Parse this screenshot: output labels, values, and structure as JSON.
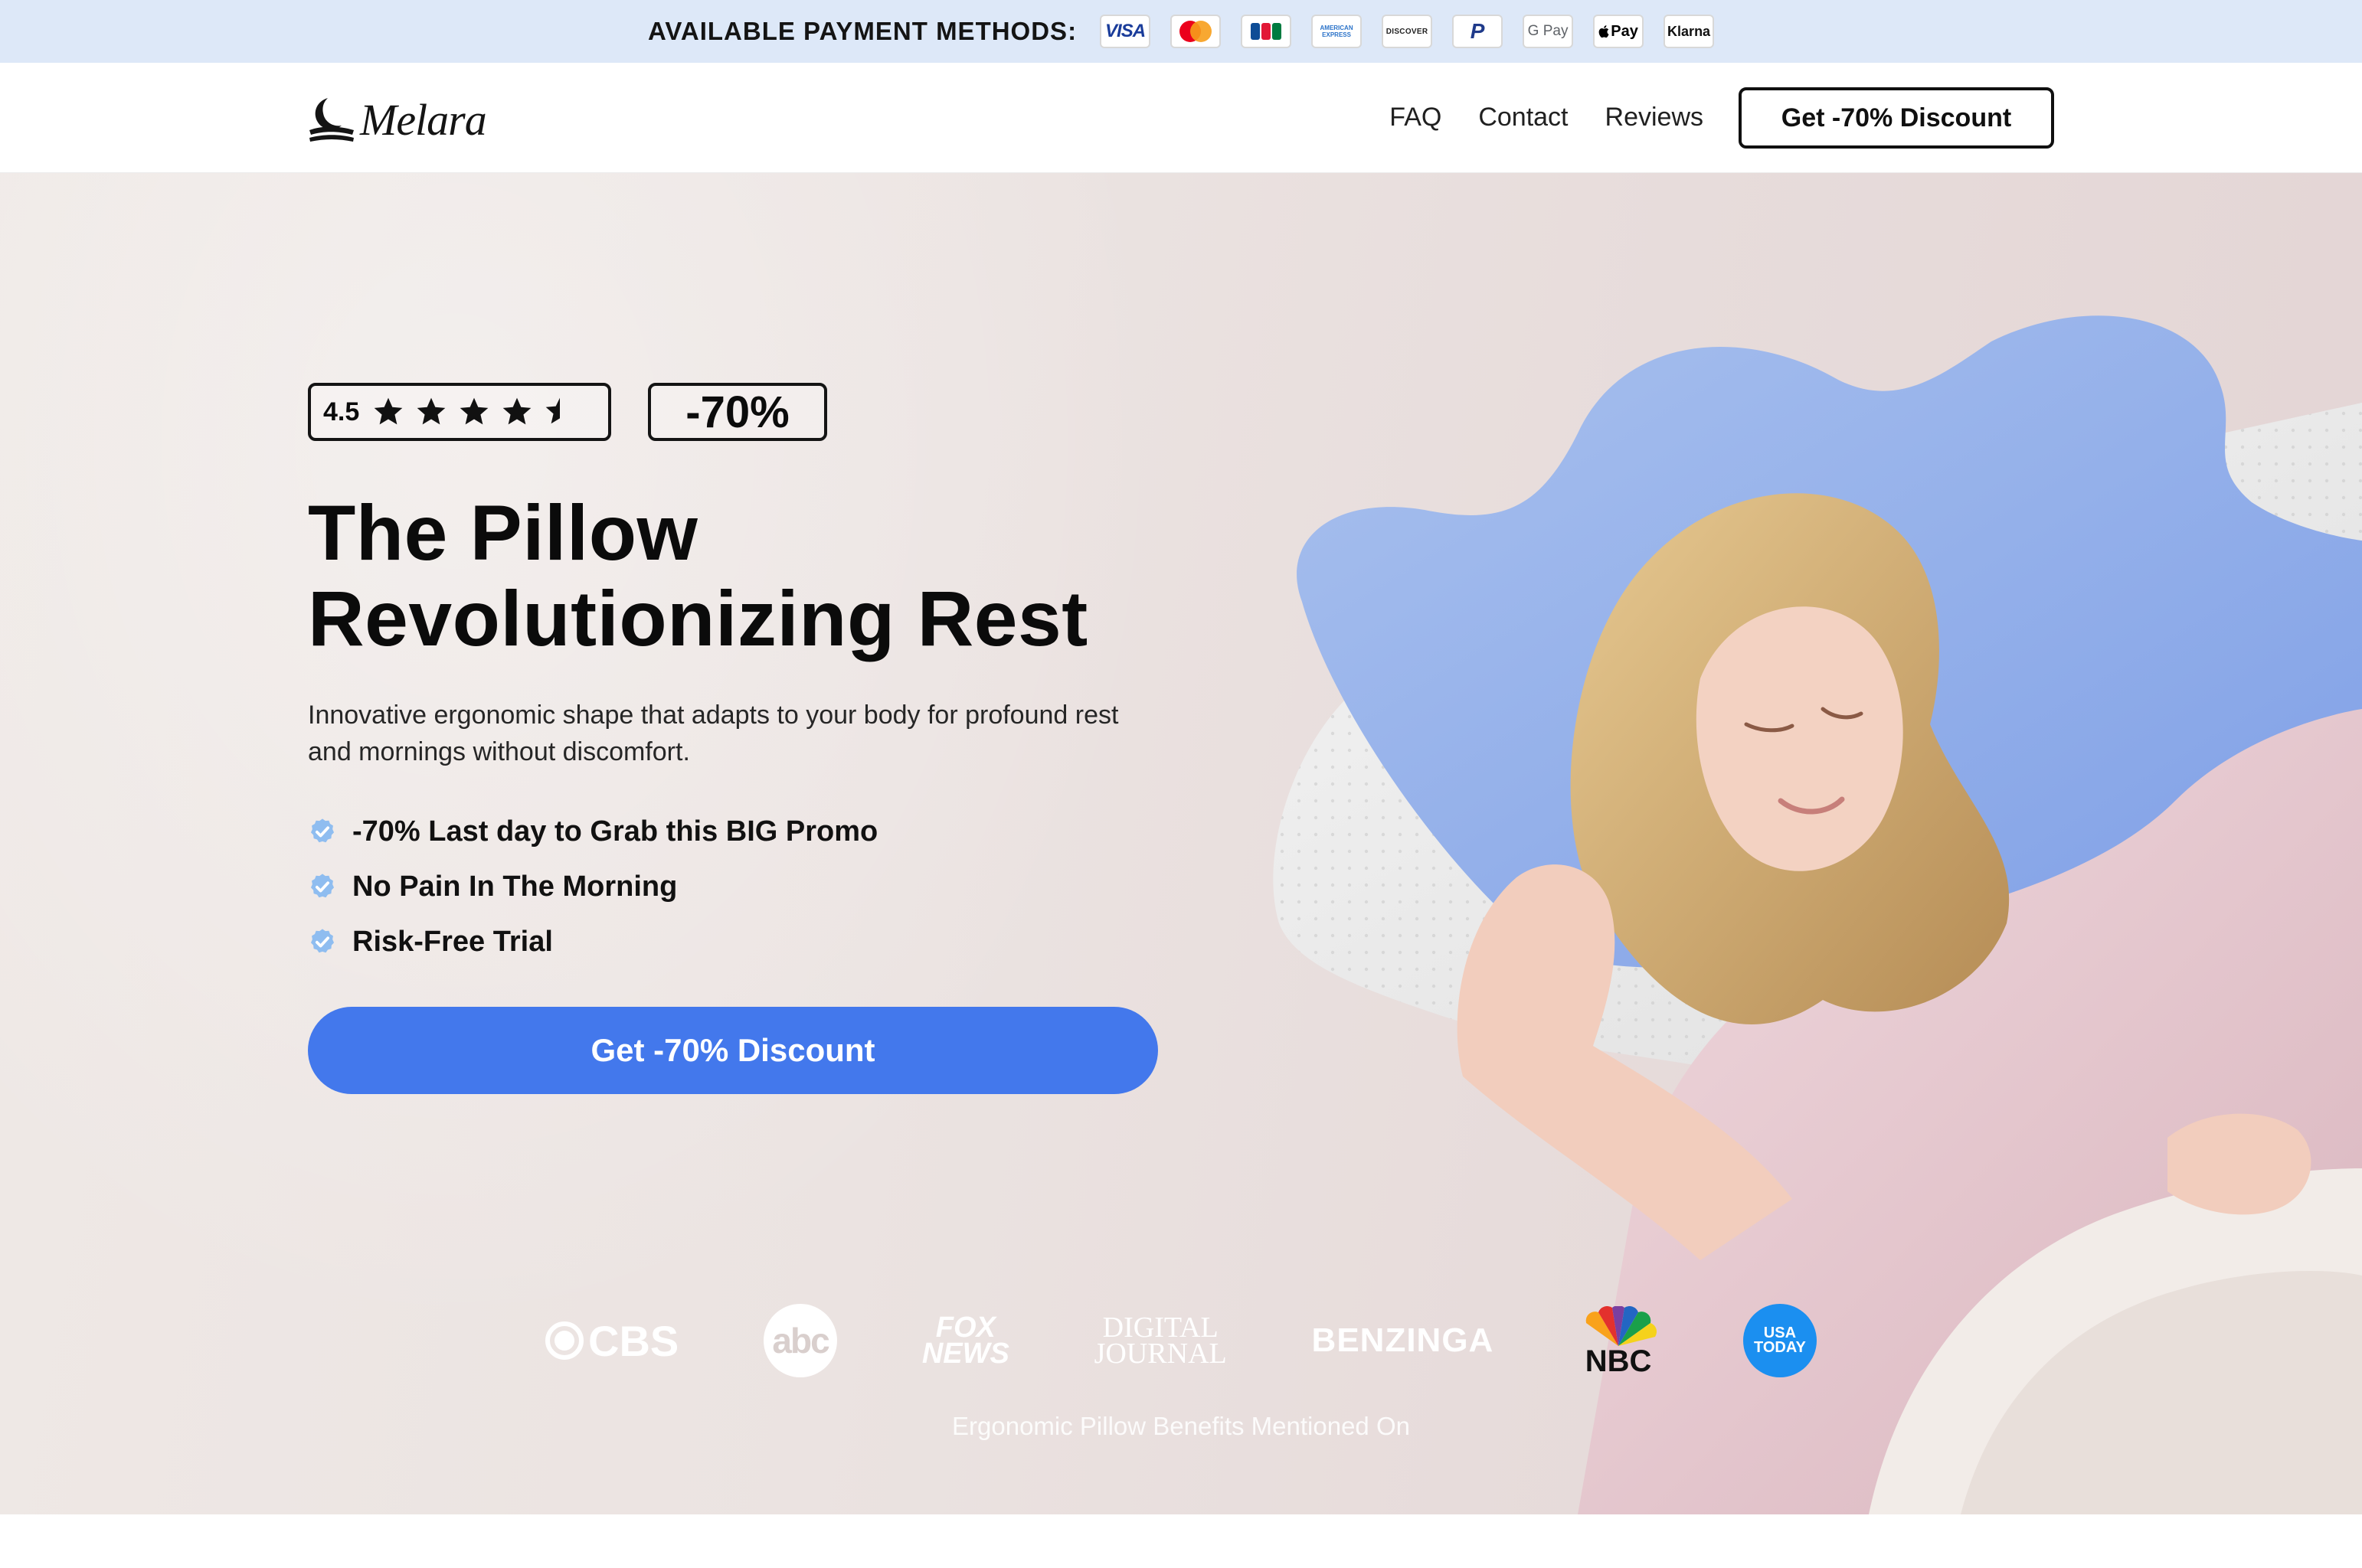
{
  "payment_bar": {
    "label": "AVAILABLE PAYMENT METHODS:",
    "methods": [
      {
        "name": "visa-icon",
        "text": "VISA"
      },
      {
        "name": "mastercard-icon",
        "text": ""
      },
      {
        "name": "jcb-icon",
        "text": ""
      },
      {
        "name": "amex-icon",
        "text": "AMERICAN EXPRESS"
      },
      {
        "name": "discover-icon",
        "text": "DISCOVER"
      },
      {
        "name": "paypal-icon",
        "text": "P"
      },
      {
        "name": "google-pay-icon",
        "text": "G Pay"
      },
      {
        "name": "apple-pay-icon",
        "text": "Pay"
      },
      {
        "name": "klarna-icon",
        "text": "Klarna"
      }
    ],
    "background": "#dde8f8"
  },
  "header": {
    "logo_text": "Melara",
    "nav": [
      "FAQ",
      "Contact",
      "Reviews"
    ],
    "cta": "Get -70% Discount"
  },
  "hero": {
    "rating": {
      "value": "4.5",
      "stars": 4.5,
      "max": 5
    },
    "discount_badge": "-70%",
    "title_lines": [
      "The Pillow",
      "Revolutionizing Rest"
    ],
    "subtitle": "Innovative ergonomic shape that adapts to your body for profound rest and mornings without discomfort.",
    "features": [
      "-70% Last day to Grab this BIG Promo",
      "No Pain In The Morning",
      "Risk-Free Trial"
    ],
    "cta": "Get -70% Discount",
    "press_caption": "Ergonomic Pillow Benefits Mentioned On",
    "press_logos": [
      {
        "name": "cbs-logo",
        "text": "CBS"
      },
      {
        "name": "abc-logo",
        "text": "abc"
      },
      {
        "name": "fox-news-logo",
        "line1": "FOX",
        "line2": "NEWS"
      },
      {
        "name": "digital-journal-logo",
        "line1": "DIGITAL",
        "line2": "JOURNAL"
      },
      {
        "name": "benzinga-logo",
        "text": "BENZINGA"
      },
      {
        "name": "nbc-logo",
        "text": "NBC"
      },
      {
        "name": "usa-today-logo",
        "line1": "USA",
        "line2": "TODAY"
      }
    ]
  },
  "colors": {
    "accent": "#4378ec",
    "text": "#0b0b0b",
    "check": "#8fbdf0"
  }
}
